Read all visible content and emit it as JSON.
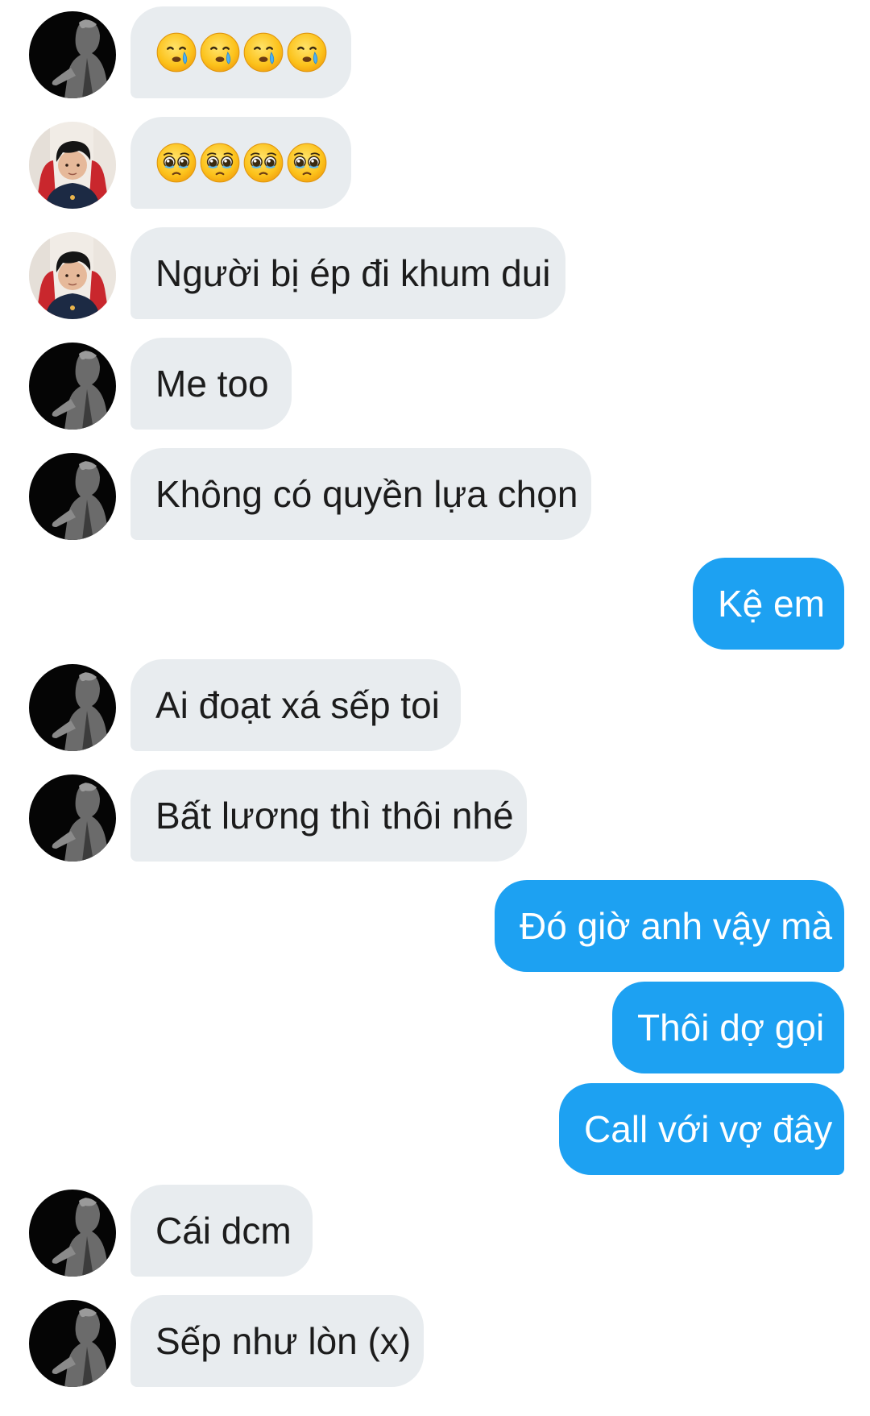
{
  "conversation": {
    "messages": [
      {
        "side": "in",
        "sender": "dark",
        "emoji": [
          "face-holding-back-tears-icon",
          "face-holding-back-tears-icon",
          "face-holding-back-tears-icon",
          "face-holding-back-tears-icon"
        ],
        "emoji_kind": "drool-tear"
      },
      {
        "side": "in",
        "sender": "photo",
        "emoji": [
          "pleading-face-icon",
          "pleading-face-icon",
          "pleading-face-icon",
          "pleading-face-icon"
        ],
        "emoji_kind": "pleading"
      },
      {
        "side": "in",
        "sender": "photo",
        "text": "Người bị ép đi khum dui"
      },
      {
        "side": "in",
        "sender": "dark",
        "text": "Me too"
      },
      {
        "side": "in",
        "sender": "dark",
        "text": "Không có quyền lựa chọn"
      },
      {
        "side": "out",
        "text": "Kệ em"
      },
      {
        "side": "in",
        "sender": "dark",
        "text": "Ai đoạt xá sếp toi"
      },
      {
        "side": "in",
        "sender": "dark",
        "text": "Bất lương thì thôi nhé"
      },
      {
        "side": "out",
        "text": "Đó giờ anh vậy mà"
      },
      {
        "side": "out",
        "text": "Thôi dợ gọi"
      },
      {
        "side": "out",
        "text": "Call với vợ đây"
      },
      {
        "side": "in",
        "sender": "dark",
        "text": "Cái dcm"
      },
      {
        "side": "in",
        "sender": "dark",
        "text": "Sếp như lòn (x)"
      }
    ]
  },
  "colors": {
    "incoming_bubble": "#e8ecef",
    "outgoing_bubble": "#1da1f2",
    "incoming_text": "#1c1c1c",
    "outgoing_text": "#ffffff",
    "background": "#ffffff"
  }
}
